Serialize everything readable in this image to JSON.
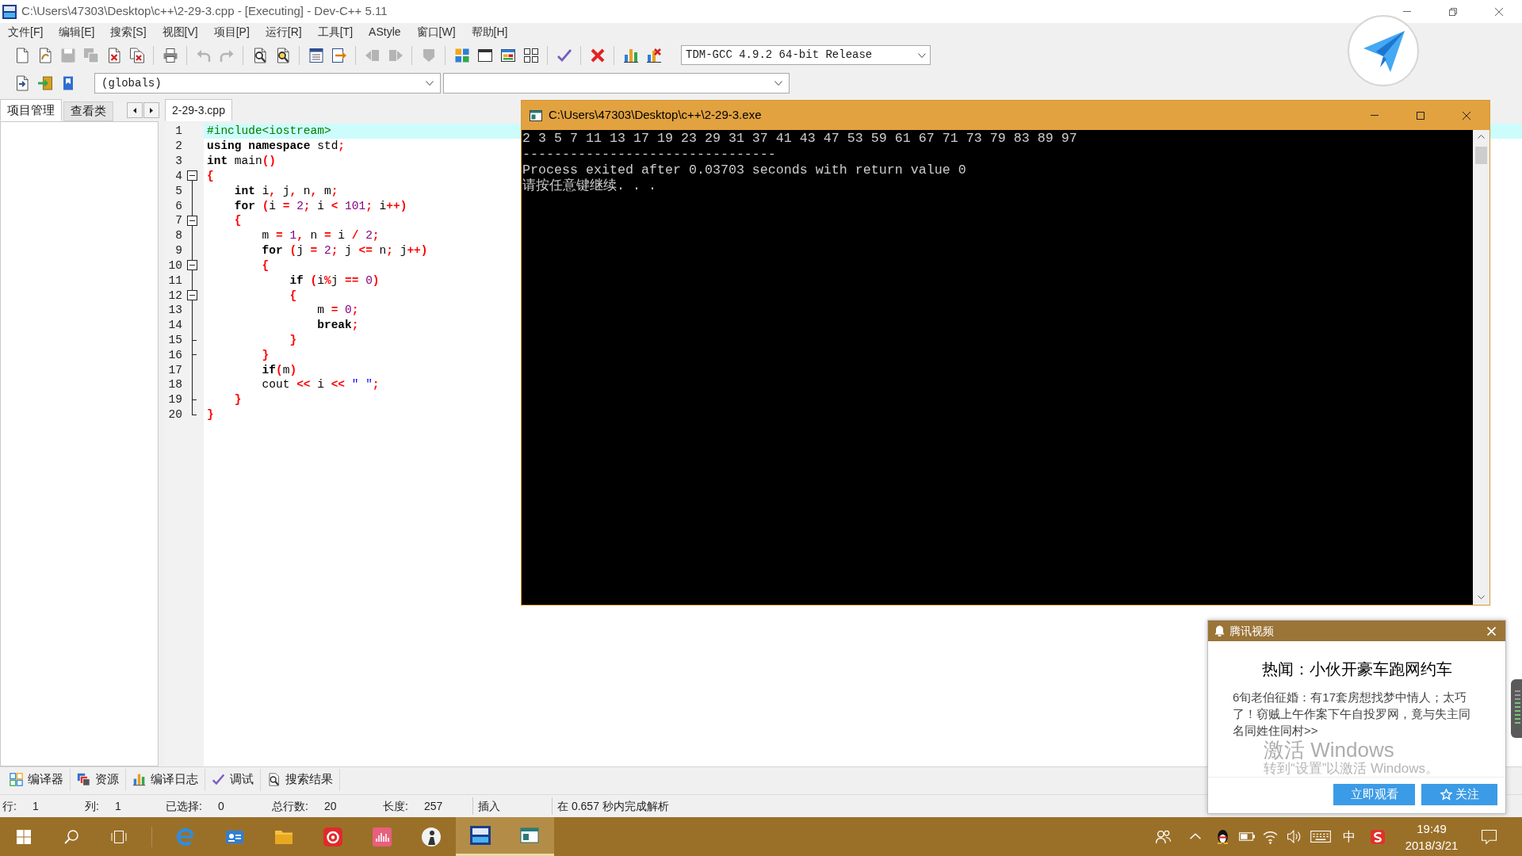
{
  "window": {
    "title": "C:\\Users\\47303\\Desktop\\c++\\2-29-3.cpp - [Executing] - Dev-C++ 5.11"
  },
  "menu": [
    "文件[F]",
    "编辑[E]",
    "搜索[S]",
    "视图[V]",
    "项目[P]",
    "运行[R]",
    "工具[T]",
    "AStyle",
    "窗口[W]",
    "帮助[H]"
  ],
  "toolbar": {
    "groups": [
      {
        "buttons": [
          {
            "kind": "new",
            "disabled": false
          },
          {
            "kind": "open",
            "disabled": false
          },
          {
            "kind": "save",
            "disabled": true
          },
          {
            "kind": "saveall",
            "disabled": true
          },
          {
            "kind": "close",
            "disabled": false
          },
          {
            "kind": "closeall",
            "disabled": false
          }
        ]
      },
      {
        "buttons": [
          {
            "kind": "print",
            "disabled": false
          }
        ]
      },
      {
        "buttons": [
          {
            "kind": "undo",
            "disabled": true
          },
          {
            "kind": "redo",
            "disabled": true
          }
        ]
      },
      {
        "buttons": [
          {
            "kind": "find",
            "disabled": false
          },
          {
            "kind": "replace",
            "disabled": false
          }
        ]
      },
      {
        "buttons": [
          {
            "kind": "goto",
            "disabled": false
          },
          {
            "kind": "jump",
            "disabled": false
          }
        ]
      },
      {
        "buttons": [
          {
            "kind": "indent",
            "disabled": true
          },
          {
            "kind": "unindent",
            "disabled": true
          }
        ]
      },
      {
        "buttons": [
          {
            "kind": "comment",
            "disabled": true
          }
        ]
      },
      {
        "buttons": [
          {
            "kind": "compile",
            "disabled": false
          },
          {
            "kind": "run",
            "disabled": false
          },
          {
            "kind": "compilerun",
            "disabled": false
          },
          {
            "kind": "rebuild",
            "disabled": false
          }
        ]
      },
      {
        "buttons": [
          {
            "kind": "check",
            "disabled": false
          }
        ]
      },
      {
        "buttons": [
          {
            "kind": "stop",
            "disabled": false
          }
        ]
      },
      {
        "buttons": [
          {
            "kind": "profile",
            "disabled": false
          },
          {
            "kind": "unprofile",
            "disabled": false
          }
        ]
      }
    ],
    "compiler": "TDM-GCC 4.9.2 64-bit Release"
  },
  "toolbar2": {
    "buttons": [
      {
        "kind": "insert"
      },
      {
        "kind": "toggle"
      },
      {
        "kind": "bookmark"
      }
    ],
    "scope": "(globals)"
  },
  "project_panel": {
    "tabs": [
      {
        "label": "项目管理",
        "selected": true
      },
      {
        "label": "查看类",
        "selected": false
      }
    ]
  },
  "editor": {
    "tabs": [
      {
        "label": "2-29-3.cpp",
        "selected": true
      }
    ],
    "lines": [
      {
        "number": "1",
        "kind": "plain",
        "current": true,
        "tokens": [
          {
            "kind": "preprocessor",
            "text": "#include<iostream>"
          }
        ]
      },
      {
        "number": "2",
        "kind": "plain",
        "current": false,
        "tokens": [
          {
            "kind": "keyword",
            "text": "using namespace "
          },
          {
            "kind": "identifier",
            "text": "std"
          },
          {
            "kind": "symbol",
            "text": ";"
          }
        ]
      },
      {
        "number": "3",
        "kind": "plain",
        "current": false,
        "tokens": [
          {
            "kind": "keyword",
            "text": "int "
          },
          {
            "kind": "identifier",
            "text": "main"
          },
          {
            "kind": "symbol",
            "text": "()"
          }
        ]
      },
      {
        "number": "4",
        "kind": "open",
        "expanded": true,
        "current": false,
        "tokens": [
          {
            "kind": "symbol",
            "text": "{"
          }
        ]
      },
      {
        "number": "5",
        "kind": "inside",
        "current": false,
        "tokens": [
          {
            "kind": "keyword",
            "text": "    int "
          },
          {
            "kind": "identifier",
            "text": "i"
          },
          {
            "kind": "symbol",
            "text": ", "
          },
          {
            "kind": "identifier",
            "text": "j"
          },
          {
            "kind": "symbol",
            "text": ", "
          },
          {
            "kind": "identifier",
            "text": "n"
          },
          {
            "kind": "symbol",
            "text": ", "
          },
          {
            "kind": "identifier",
            "text": "m"
          },
          {
            "kind": "symbol",
            "text": ";"
          }
        ]
      },
      {
        "number": "6",
        "kind": "inside",
        "current": false,
        "tokens": [
          {
            "kind": "keyword",
            "text": "    for "
          },
          {
            "kind": "symbol",
            "text": "("
          },
          {
            "kind": "identifier",
            "text": "i "
          },
          {
            "kind": "symbol",
            "text": "= "
          },
          {
            "kind": "number",
            "text": "2"
          },
          {
            "kind": "symbol",
            "text": "; "
          },
          {
            "kind": "identifier",
            "text": "i "
          },
          {
            "kind": "symbol",
            "text": "< "
          },
          {
            "kind": "number",
            "text": "101"
          },
          {
            "kind": "symbol",
            "text": "; "
          },
          {
            "kind": "identifier",
            "text": "i"
          },
          {
            "kind": "symbol",
            "text": "++)"
          }
        ]
      },
      {
        "number": "7",
        "kind": "open",
        "expanded": true,
        "current": false,
        "tokens": [
          {
            "kind": "symbol",
            "text": "    {"
          }
        ]
      },
      {
        "number": "8",
        "kind": "inside",
        "current": false,
        "tokens": [
          {
            "kind": "identifier",
            "text": "        m "
          },
          {
            "kind": "symbol",
            "text": "= "
          },
          {
            "kind": "number",
            "text": "1"
          },
          {
            "kind": "symbol",
            "text": ", "
          },
          {
            "kind": "identifier",
            "text": "n "
          },
          {
            "kind": "symbol",
            "text": "= "
          },
          {
            "kind": "identifier",
            "text": "i "
          },
          {
            "kind": "symbol",
            "text": "/ "
          },
          {
            "kind": "number",
            "text": "2"
          },
          {
            "kind": "symbol",
            "text": ";"
          }
        ]
      },
      {
        "number": "9",
        "kind": "inside",
        "current": false,
        "tokens": [
          {
            "kind": "keyword",
            "text": "        for "
          },
          {
            "kind": "symbol",
            "text": "("
          },
          {
            "kind": "identifier",
            "text": "j "
          },
          {
            "kind": "symbol",
            "text": "= "
          },
          {
            "kind": "number",
            "text": "2"
          },
          {
            "kind": "symbol",
            "text": "; "
          },
          {
            "kind": "identifier",
            "text": "j "
          },
          {
            "kind": "symbol",
            "text": "<= "
          },
          {
            "kind": "identifier",
            "text": "n"
          },
          {
            "kind": "symbol",
            "text": "; "
          },
          {
            "kind": "identifier",
            "text": "j"
          },
          {
            "kind": "symbol",
            "text": "++)"
          }
        ]
      },
      {
        "number": "10",
        "kind": "open",
        "expanded": true,
        "current": false,
        "tokens": [
          {
            "kind": "symbol",
            "text": "        {"
          }
        ]
      },
      {
        "number": "11",
        "kind": "inside",
        "current": false,
        "tokens": [
          {
            "kind": "keyword",
            "text": "            if "
          },
          {
            "kind": "symbol",
            "text": "("
          },
          {
            "kind": "identifier",
            "text": "i"
          },
          {
            "kind": "symbol",
            "text": "%"
          },
          {
            "kind": "identifier",
            "text": "j "
          },
          {
            "kind": "symbol",
            "text": "== "
          },
          {
            "kind": "number",
            "text": "0"
          },
          {
            "kind": "symbol",
            "text": ")"
          }
        ]
      },
      {
        "number": "12",
        "kind": "open",
        "expanded": true,
        "current": false,
        "tokens": [
          {
            "kind": "symbol",
            "text": "            {"
          }
        ]
      },
      {
        "number": "13",
        "kind": "inside",
        "current": false,
        "tokens": [
          {
            "kind": "identifier",
            "text": "                m "
          },
          {
            "kind": "symbol",
            "text": "= "
          },
          {
            "kind": "number",
            "text": "0"
          },
          {
            "kind": "symbol",
            "text": ";"
          }
        ]
      },
      {
        "number": "14",
        "kind": "inside",
        "current": false,
        "tokens": [
          {
            "kind": "keyword",
            "text": "                break"
          },
          {
            "kind": "symbol",
            "text": ";"
          }
        ]
      },
      {
        "number": "15",
        "kind": "close",
        "current": false,
        "tokens": [
          {
            "kind": "symbol",
            "text": "            }"
          }
        ]
      },
      {
        "number": "16",
        "kind": "close",
        "current": false,
        "tokens": [
          {
            "kind": "symbol",
            "text": "        }"
          }
        ]
      },
      {
        "number": "17",
        "kind": "inside",
        "current": false,
        "tokens": [
          {
            "kind": "keyword",
            "text": "        if"
          },
          {
            "kind": "symbol",
            "text": "("
          },
          {
            "kind": "identifier",
            "text": "m"
          },
          {
            "kind": "symbol",
            "text": ")"
          }
        ]
      },
      {
        "number": "18",
        "kind": "inside",
        "current": false,
        "tokens": [
          {
            "kind": "identifier",
            "text": "        cout "
          },
          {
            "kind": "symbol",
            "text": "<< "
          },
          {
            "kind": "identifier",
            "text": "i "
          },
          {
            "kind": "symbol",
            "text": "<< "
          },
          {
            "kind": "string",
            "text": "\" \""
          },
          {
            "kind": "symbol",
            "text": ";"
          }
        ]
      },
      {
        "number": "19",
        "kind": "close",
        "current": false,
        "tokens": [
          {
            "kind": "symbol",
            "text": "    }"
          }
        ]
      },
      {
        "number": "20",
        "kind": "last",
        "current": false,
        "tokens": [
          {
            "kind": "symbol",
            "text": "}"
          }
        ]
      }
    ]
  },
  "console": {
    "title": "C:\\Users\\47303\\Desktop\\c++\\2-29-3.exe",
    "lines": [
      "2 3 5 7 11 13 17 19 23 29 31 37 41 43 47 53 59 61 67 71 73 79 83 89 97",
      "--------------------------------",
      "Process exited after 0.03703 seconds with return value 0",
      "请按任意键继续. . ."
    ]
  },
  "bottom_tabs": [
    {
      "kind": "compiler",
      "label": "编译器",
      "selected": false
    },
    {
      "kind": "resources",
      "label": "资源",
      "selected": false
    },
    {
      "kind": "log",
      "label": "编译日志",
      "selected": false
    },
    {
      "kind": "debug",
      "label": "调试",
      "selected": false
    },
    {
      "kind": "search",
      "label": "搜索结果",
      "selected": false
    }
  ],
  "status_bar": {
    "fields": [
      {
        "label": "行:",
        "value": "1"
      },
      {
        "label": "列:",
        "value": "1"
      },
      {
        "label": "已选择:",
        "value": "0"
      },
      {
        "label": "总行数:",
        "value": "20"
      },
      {
        "label": "长度:",
        "value": "257"
      }
    ],
    "mode": "插入",
    "message": "在 0.657 秒内完成解析"
  },
  "notification": {
    "app": "腾讯视频",
    "headline": "热闻：小伙开豪车跑网约车",
    "body": "6旬老伯征婚：有17套房想找梦中情人；太巧了！窃贼上午作案下午自投罗网，竟与失主同名同姓住同村>>",
    "buttons": [
      {
        "kind": "watch",
        "label": "立即观看"
      },
      {
        "kind": "follow",
        "label": "关注"
      }
    ]
  },
  "windows_activation": {
    "title": "激活 Windows",
    "hint": "转到“设置”以激活 Windows。"
  },
  "taskbar": {
    "buttons": [
      {
        "kind": "start"
      },
      {
        "kind": "search"
      },
      {
        "kind": "taskview"
      }
    ],
    "apps": [
      {
        "kind": "browser",
        "active": false
      },
      {
        "kind": "card",
        "active": false
      },
      {
        "kind": "explorer",
        "active": false
      },
      {
        "kind": "music",
        "active": false
      },
      {
        "kind": "audio",
        "active": false
      },
      {
        "kind": "sphere",
        "active": false
      },
      {
        "kind": "devcpp",
        "active": true
      },
      {
        "kind": "console",
        "active": true
      }
    ],
    "tray": [
      {
        "kind": "people"
      },
      {
        "kind": "chevron"
      },
      {
        "kind": "penguin"
      },
      {
        "kind": "battery"
      },
      {
        "kind": "wifi"
      },
      {
        "kind": "volume"
      },
      {
        "kind": "keyboard"
      },
      {
        "kind": "ime",
        "text": "中"
      },
      {
        "kind": "sogou"
      }
    ],
    "time": "19:49",
    "date": "2018/3/21"
  }
}
